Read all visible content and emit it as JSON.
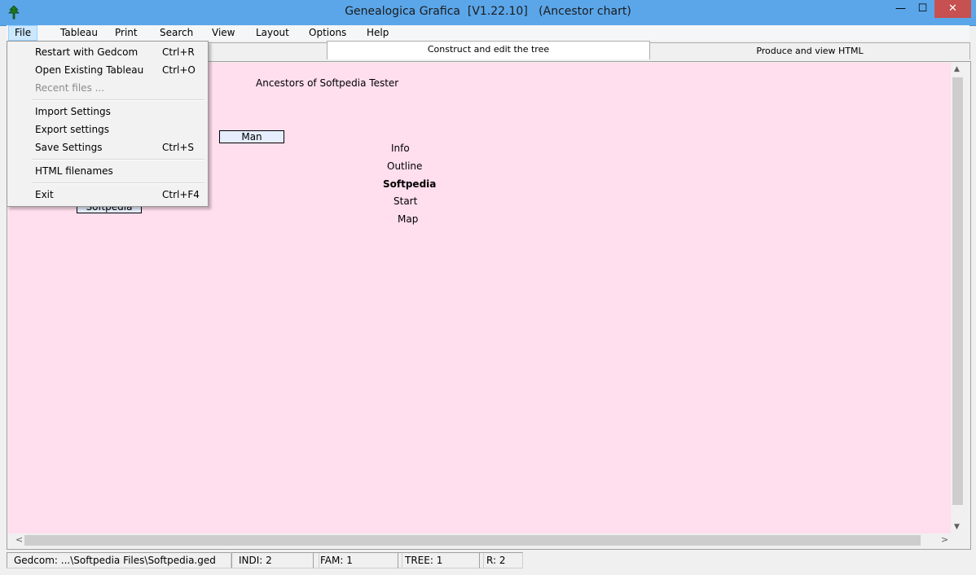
{
  "window": {
    "title": "Genealogica Grafica  [V1.22.10]   (Ancestor chart)",
    "min_glyph": "—",
    "max_glyph": "☐",
    "close_glyph": "✕",
    "title_bar_color": "#5ba6e9",
    "close_color": "#c75050"
  },
  "menubar": {
    "items": [
      "File",
      "Tableau",
      "Print",
      "Search",
      "View",
      "Layout",
      "Options",
      "Help"
    ]
  },
  "tabs": [
    {
      "label": "Construct and edit the tree"
    },
    {
      "label": "Produce and view HTML"
    }
  ],
  "canvas": {
    "heading": "Ancestors of Softpedia Tester",
    "man_box": "Man",
    "softpedia_box": "Softpedia",
    "links": [
      "Info",
      "Outline",
      "Softpedia",
      "Start",
      "Map"
    ],
    "background": "#ffdeed"
  },
  "file_menu": {
    "items": [
      {
        "label": "Restart with Gedcom",
        "shortcut": "Ctrl+R"
      },
      {
        "label": "Open Existing Tableau",
        "shortcut": "Ctrl+O"
      },
      {
        "label": "Recent files ...",
        "shortcut": ""
      },
      {
        "label": "Import Settings",
        "shortcut": ""
      },
      {
        "label": "Export settings",
        "shortcut": ""
      },
      {
        "label": "Save Settings",
        "shortcut": "Ctrl+S"
      },
      {
        "label": "HTML filenames",
        "shortcut": ""
      },
      {
        "label": "Exit",
        "shortcut": "Ctrl+F4"
      }
    ]
  },
  "statusbar": {
    "gedcom": "Gedcom: ...\\Softpedia Files\\Softpedia.ged",
    "indi": "INDI:  2",
    "fam": "FAM:  1",
    "tree": "TREE:  1",
    "r": "R:  2"
  },
  "scroll": {
    "up": "▲",
    "down": "▼",
    "left": "<",
    "right": ">"
  }
}
